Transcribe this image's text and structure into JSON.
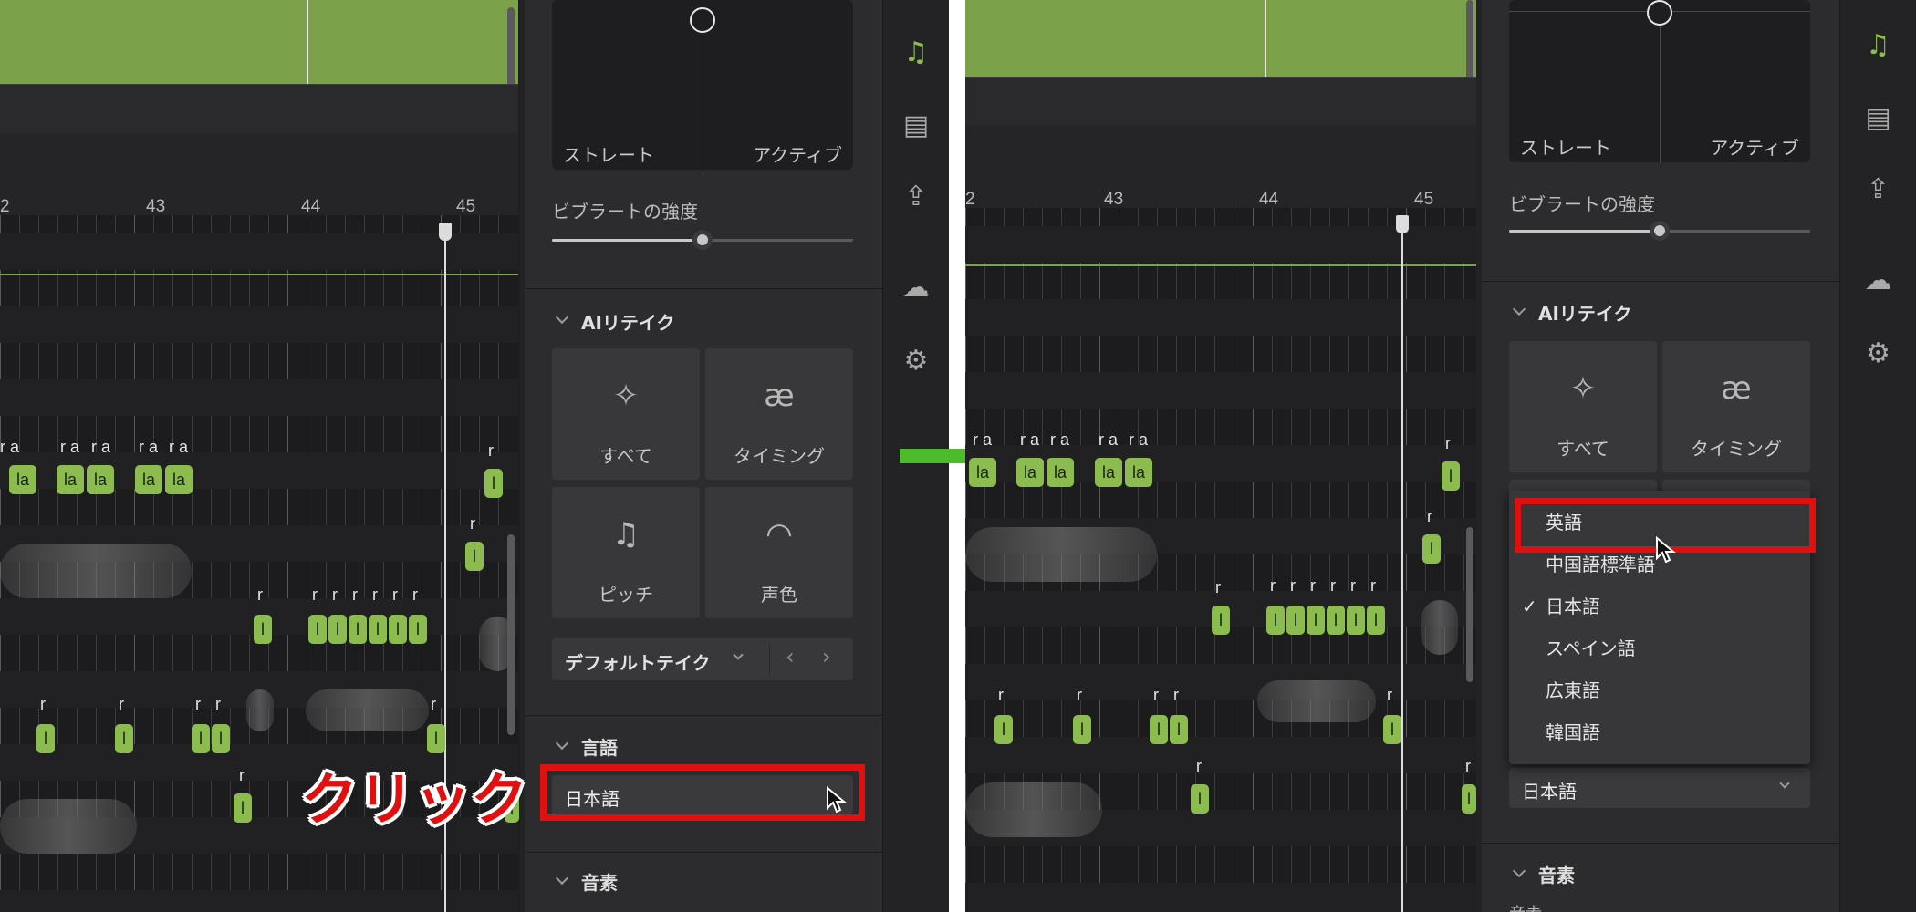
{
  "ruler": {
    "left_numbers": [
      "2",
      "43",
      "44",
      "45"
    ],
    "right_numbers": [
      "2",
      "43",
      "44",
      "45"
    ]
  },
  "pitch_panel": {
    "straight_label": "ストレート",
    "active_label": "アクティブ"
  },
  "vibrato": {
    "label": "ビブラートの強度",
    "value_percent": 50
  },
  "ai_retake": {
    "title": "AIリテイク",
    "tiles": [
      {
        "label": "すべて",
        "icon": "sparkle-icon"
      },
      {
        "label": "タイミング",
        "icon": "ae-ligature-icon",
        "glyph": "æ"
      },
      {
        "label": "ピッチ",
        "icon": "music-note-icon"
      },
      {
        "label": "声色",
        "icon": "lips-icon"
      }
    ],
    "take_select": "デフォルトテイク"
  },
  "language": {
    "title": "言語",
    "selected": "日本語"
  },
  "phoneme": {
    "title": "音素",
    "sub_label": "音素"
  },
  "annotation": {
    "click_text": "クリック"
  },
  "dropdown": {
    "options": [
      {
        "label": "英語",
        "checked": false
      },
      {
        "label": "中国語標準語",
        "checked": false
      },
      {
        "label": "日本語",
        "checked": true
      },
      {
        "label": "スペイン語",
        "checked": false
      },
      {
        "label": "広東語",
        "checked": false
      },
      {
        "label": "韓国語",
        "checked": false
      }
    ],
    "check_glyph": "✓"
  },
  "rail_icons": [
    "music-note-icon",
    "book-icon",
    "export-icon",
    "cloud-check-icon",
    "gear-icon"
  ],
  "colors": {
    "accent_green": "#8cbc4f",
    "highlight_red": "#e01010",
    "arrow_green": "#4cbb2c"
  },
  "lyrics": {
    "ra": "r a",
    "r": "r",
    "la": "la",
    "l": "l"
  }
}
